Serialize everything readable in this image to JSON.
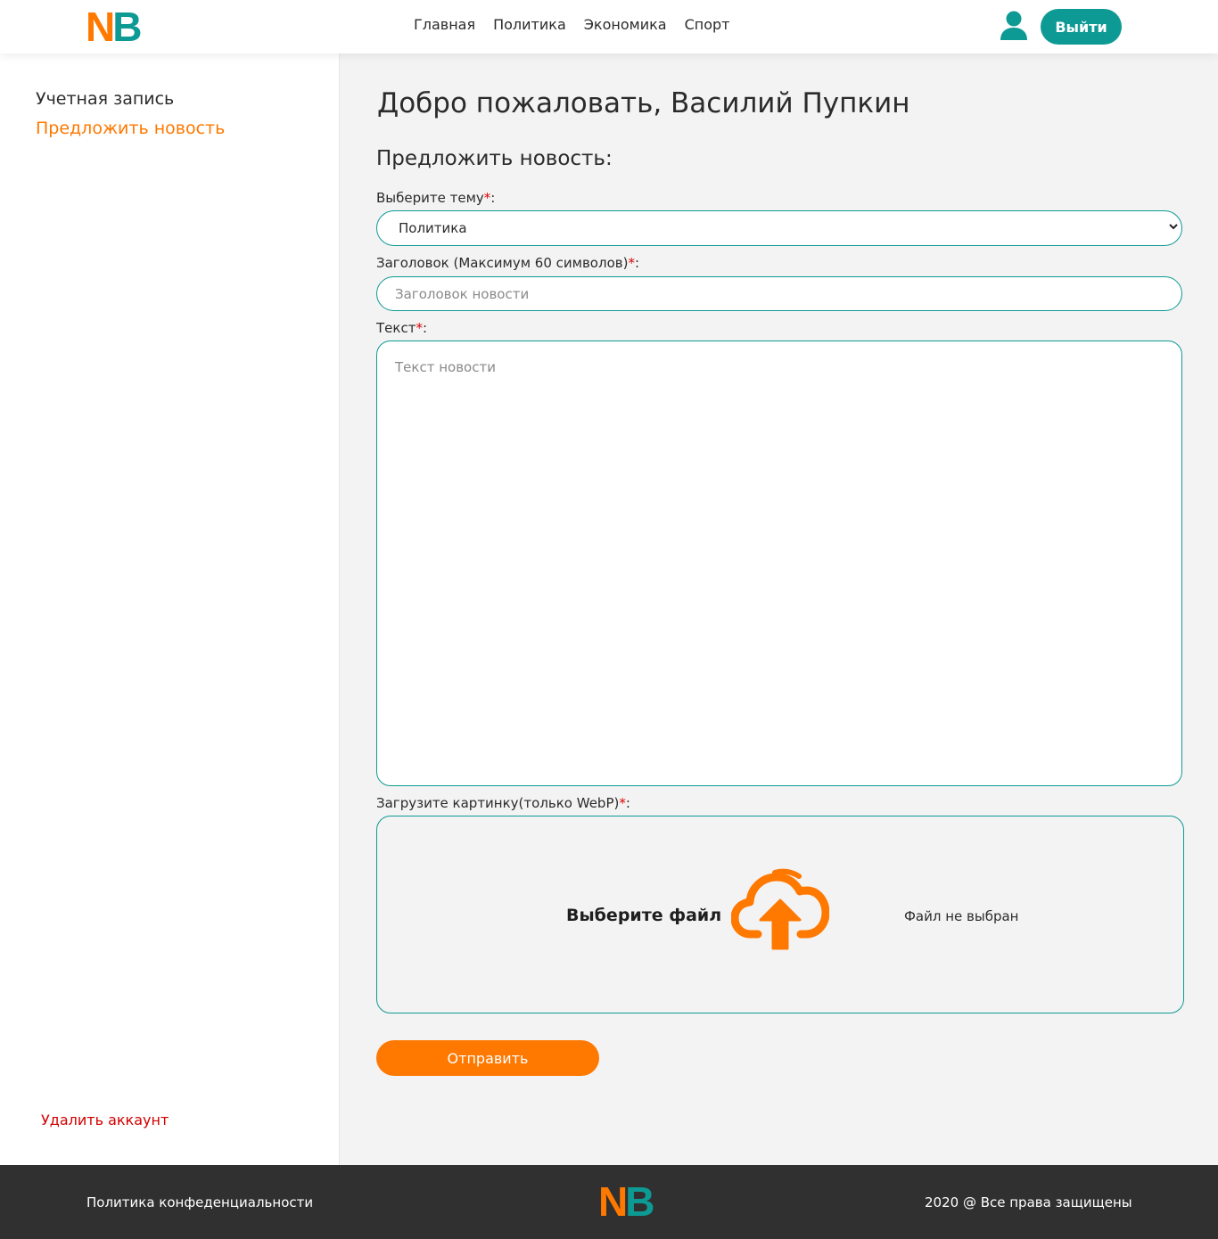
{
  "header": {
    "logo": {
      "n": "N",
      "b": "B"
    },
    "nav": [
      "Главная",
      "Политика",
      "Экономика",
      "Спорт"
    ],
    "user_icon": "user-icon",
    "logout_label": "Выйти"
  },
  "sidebar": {
    "account_label": "Учетная запись",
    "suggest_label": "Предложить новость",
    "delete_label": "Удалить аккаунт"
  },
  "main": {
    "welcome": "Добро пожаловать, Василий Пупкин",
    "section_title": "Предложить новость:",
    "topic": {
      "label": "Выберите тему",
      "required_mark": "*",
      "suffix": ":",
      "selected": "Политика"
    },
    "title": {
      "label": "Заголовок (Максимум 60 символов)",
      "required_mark": "*",
      "suffix": ":",
      "value": "",
      "placeholder": "Заголовок новости"
    },
    "text": {
      "label": "Текст",
      "required_mark": "*",
      "suffix": ":",
      "value": "",
      "placeholder": "Текст новости"
    },
    "image": {
      "label": "Загрузите картинку(только WebP)",
      "required_mark": "*",
      "suffix": ":",
      "choose_label": "Выберите файл",
      "status": "Файл не выбран",
      "icon": "cloud-upload-icon"
    },
    "submit_label": "Отправить"
  },
  "footer": {
    "policy": "Политика конфеденциальности",
    "copyright": "2020 @ Все права защищены",
    "logo": {
      "n": "N",
      "b": "B"
    }
  },
  "colors": {
    "accent_teal": "#0e9a94",
    "accent_orange": "#ff7800",
    "danger": "#d10000",
    "footer_bg": "#303030",
    "content_bg": "#f3f3f3"
  }
}
